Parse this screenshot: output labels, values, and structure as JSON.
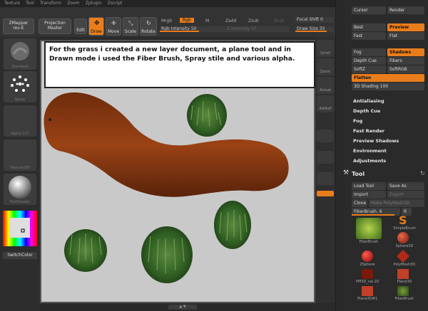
{
  "menu": [
    "Texture",
    "Tool",
    "Transform",
    "Zoom",
    "Zplugin",
    "Zscript"
  ],
  "top": {
    "zmapper": "ZMapper",
    "zmapper_sub": "rev-E",
    "projection": "Projection",
    "projection_sub": "Master",
    "edit": "Edit",
    "draw": "Draw",
    "move": "Move",
    "scale": "Scale",
    "rotate": "Rotate",
    "mrgb": "Mrgb",
    "rgb": "Rgb",
    "m": "M",
    "zadd": "Zadd",
    "zsub": "Zsub",
    "zcut": "Zcut",
    "rgb_intensity": "Rgb Intensity 50",
    "z_intensity": "Z Intensity 37",
    "focal_shift": "Focal Shift 0",
    "draw_size": "Draw Size 35"
  },
  "left": {
    "standard": "Standard",
    "spray": "Spray",
    "alpha": "Alpha 137",
    "texture": "Texture Off",
    "fastshader": "FastShader",
    "switchcolor": "SwitchColor"
  },
  "shelf": [
    "Scroll",
    "Zoom",
    "Actual",
    "AAHalf"
  ],
  "callout": "For the grass i created a new layer document, a plane tool and in Drawn mode i used the Fiber Brush, Spray stile and various alpha.",
  "right": {
    "cursor": "Cursor",
    "render": "Render",
    "best": "Best",
    "preview": "Preview",
    "fast": "Fast",
    "flat": "Flat",
    "fog": "Fog",
    "shadows": "Shadows",
    "depth_cue": "Depth Cue",
    "fibers": "Fibers",
    "softz": "SoftZ",
    "softrgb": "SoftRGB",
    "flatten": "Flatten",
    "shading": "3D Shading 100",
    "antialiasing": "Antialiasing",
    "depth_cue2": "Depth Cue",
    "fog2": "Fog",
    "fast_render": "Fast Render",
    "preview_shadows": "Preview Shadows",
    "environment": "Environment",
    "adjustments": "Adjustments",
    "tool": "Tool",
    "load_tool": "Load Tool",
    "save_as": "Save As",
    "import": "Import",
    "export": "Export",
    "clone": "Clone",
    "make_polymesh": "Make PolyMesh3D",
    "fiberbrush6": "FiberBrush. 6",
    "r": "R",
    "tools": [
      "FiberBrush",
      "SimpleBrush",
      "Sphere3D",
      "ZSphere",
      "PolyMesh3D",
      "PM3D_cal 20",
      "Plane3D",
      "Plane3D#1",
      "FiberBrush"
    ]
  },
  "colors": {
    "accent": "#e97d1c",
    "canvas_bg": "#c9c9c9",
    "body_brown": "#8a3a12",
    "grass": "#3b6e2a"
  }
}
